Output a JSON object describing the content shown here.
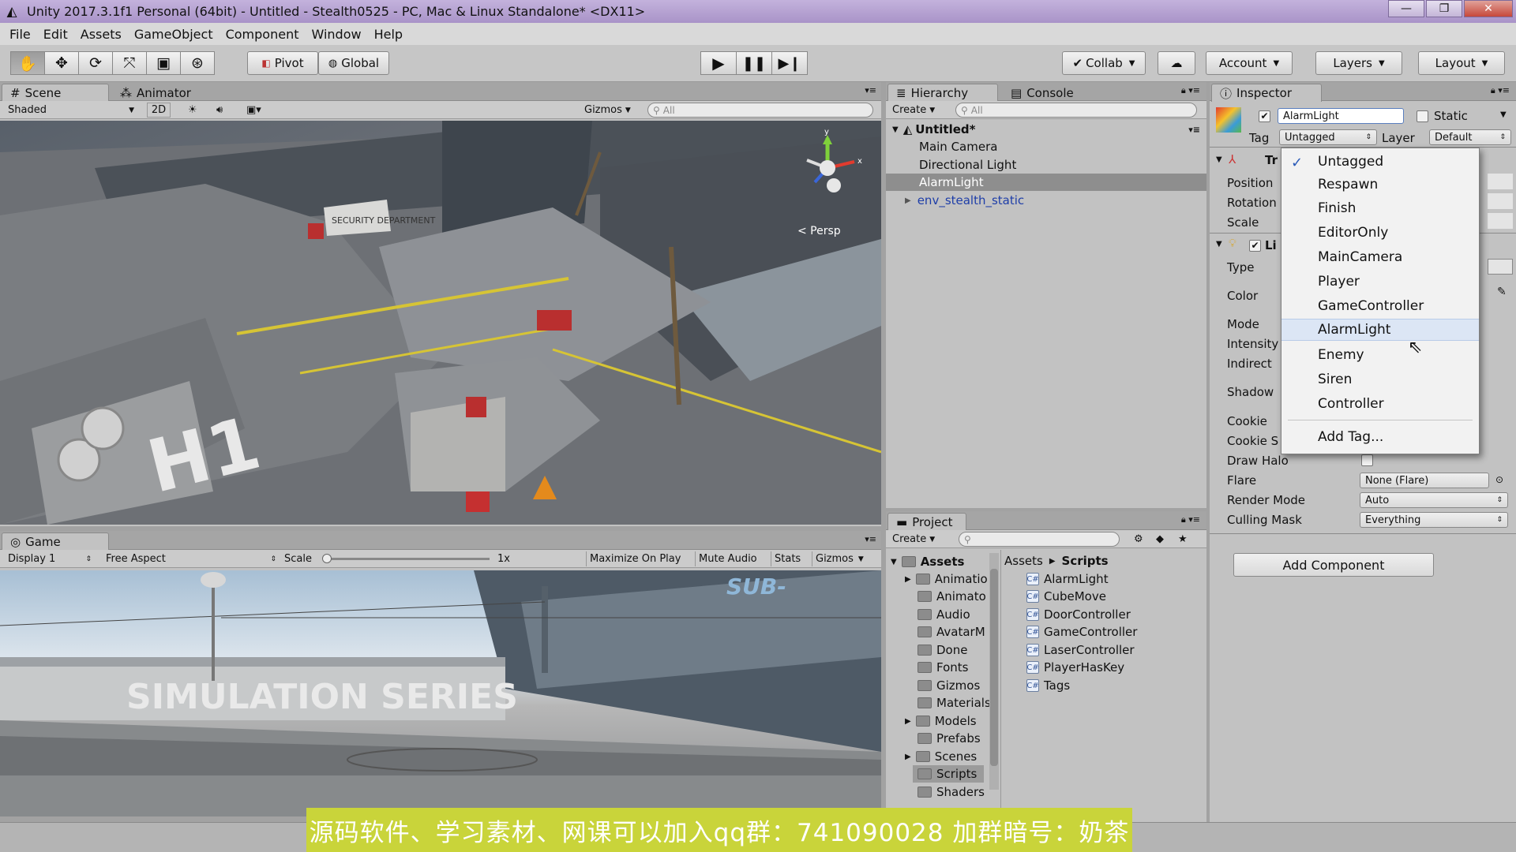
{
  "window": {
    "title": "Unity 2017.3.1f1 Personal (64bit) - Untitled - Stealth0525 - PC, Mac & Linux Standalone* <DX11>",
    "controls": [
      "—",
      "❐",
      "✕"
    ]
  },
  "menubar": [
    "File",
    "Edit",
    "Assets",
    "GameObject",
    "Component",
    "Window",
    "Help"
  ],
  "toolbar": {
    "pivot": "Pivot",
    "global": "Global",
    "collab": "Collab",
    "account": "Account",
    "layers": "Layers",
    "layout": "Layout"
  },
  "scene_panel": {
    "tabs": [
      "Scene",
      "Animator"
    ],
    "shading": "Shaded",
    "mode_2d": "2D",
    "gizmos": "Gizmos",
    "search_placeholder": "All",
    "persp": "< Persp",
    "signs": [
      "SECURITY DEPARTMENT",
      "H1"
    ]
  },
  "game_panel": {
    "tab": "Game",
    "display": "Display 1",
    "aspect": "Free Aspect",
    "scale_label": "Scale",
    "scale_value": "1x",
    "maximize": "Maximize On Play",
    "mute": "Mute Audio",
    "stats": "Stats",
    "gizmos": "Gizmos",
    "billboard": "SIMULATION SERIES",
    "sign_sub": "SUB-"
  },
  "hierarchy": {
    "tabs": [
      "Hierarchy",
      "Console"
    ],
    "create": "Create",
    "search_placeholder": "All",
    "scene_name": "Untitled*",
    "items": [
      "Main Camera",
      "Directional Light",
      "AlarmLight",
      "env_stealth_static"
    ]
  },
  "project": {
    "tab": "Project",
    "create": "Create",
    "root": "Assets",
    "folders": [
      "Animatio",
      "Animato",
      "Audio",
      "AvatarM",
      "Done",
      "Fonts",
      "Gizmos",
      "Materials",
      "Models",
      "Prefabs",
      "Scenes",
      "Scripts",
      "Shaders"
    ],
    "breadcrumb": [
      "Assets",
      "Scripts"
    ],
    "scripts": [
      "AlarmLight",
      "CubeMove",
      "DoorController",
      "GameController",
      "LaserController",
      "PlayerHasKey",
      "Tags"
    ]
  },
  "inspector": {
    "tab": "Inspector",
    "object_name": "AlarmLight",
    "static_label": "Static",
    "tag_label": "Tag",
    "tag_value": "Untagged",
    "layer_label": "Layer",
    "layer_value": "Default",
    "transform_header": "Tr",
    "transform_fields": [
      "Position",
      "Rotation",
      "Scale"
    ],
    "light_header": "Li",
    "light_fields": [
      "Type",
      "Color",
      "Mode",
      "Intensity",
      "Indirect",
      "Shadow",
      "Cookie",
      "Cookie S"
    ],
    "draw_halo": "Draw Halo",
    "flare": "Flare",
    "flare_value": "None (Flare)",
    "render_mode": "Render Mode",
    "render_mode_value": "Auto",
    "culling_mask": "Culling Mask",
    "culling_mask_value": "Everything",
    "add_component": "Add Component"
  },
  "tag_dropdown": {
    "items": [
      "Untagged",
      "Respawn",
      "Finish",
      "EditorOnly",
      "MainCamera",
      "Player",
      "GameController",
      "AlarmLight",
      "Enemy",
      "Siren",
      "Controller"
    ],
    "checked": "Untagged",
    "highlighted": "AlarmLight",
    "add_tag": "Add Tag..."
  },
  "watermark": "源码软件、学习素材、网课可以加入qq群：741090028 加群暗号：奶茶",
  "colors": {
    "title_bar": "#b19cd0",
    "panel_bg": "#c2c2c2",
    "selection": "#8e8e8e",
    "watermark_bg": "#c9d43a",
    "link_blue": "#1e3ea8",
    "gizmo_y": "#7fd13b",
    "gizmo_x": "#e23b2e",
    "gizmo_z": "#3a66d9"
  }
}
